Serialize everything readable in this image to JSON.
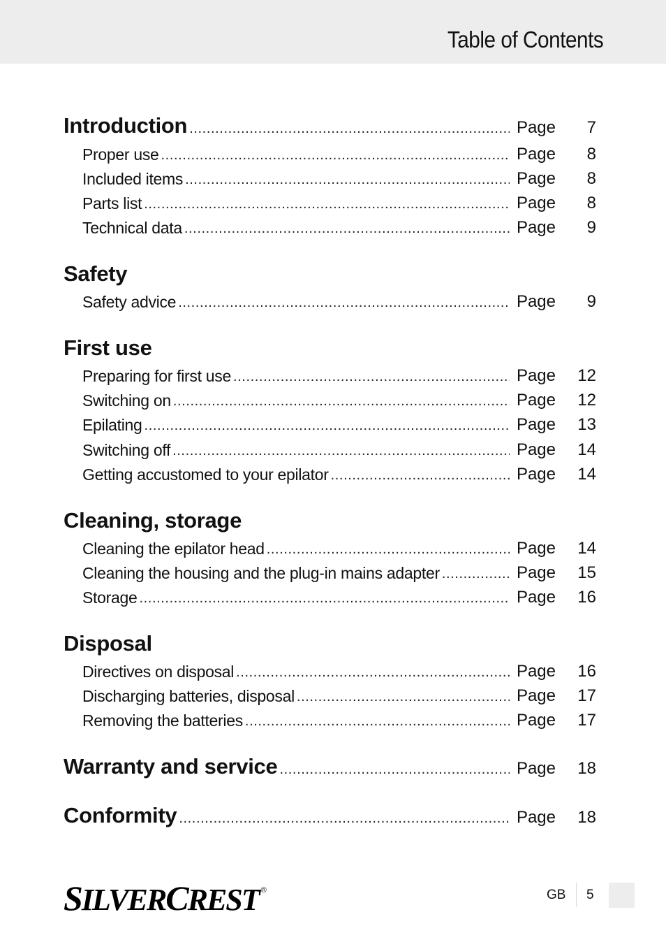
{
  "header": {
    "title": "Table of Contents"
  },
  "toc": {
    "page_word": "Page",
    "sections": [
      {
        "title": "Introduction",
        "page": "7",
        "items": [
          {
            "label": "Proper use",
            "page": "8"
          },
          {
            "label": "Included items",
            "page": "8"
          },
          {
            "label": "Parts list",
            "page": "8"
          },
          {
            "label": "Technical data",
            "page": "9"
          }
        ]
      },
      {
        "title": "Safety",
        "page": null,
        "items": [
          {
            "label": "Safety advice",
            "page": "9"
          }
        ]
      },
      {
        "title": "First use",
        "page": null,
        "items": [
          {
            "label": "Preparing for first use",
            "page": "12"
          },
          {
            "label": "Switching on",
            "page": "12"
          },
          {
            "label": "Epilating",
            "page": "13"
          },
          {
            "label": "Switching off",
            "page": "14"
          },
          {
            "label": "Getting accustomed to your epilator",
            "page": "14"
          }
        ]
      },
      {
        "title": "Cleaning, storage",
        "page": null,
        "items": [
          {
            "label": "Cleaning the epilator head",
            "page": "14"
          },
          {
            "label": "Cleaning the housing and the plug-in mains adapter",
            "page": "15"
          },
          {
            "label": "Storage",
            "page": "16"
          }
        ]
      },
      {
        "title": "Disposal",
        "page": null,
        "items": [
          {
            "label": "Directives on disposal",
            "page": "16"
          },
          {
            "label": "Discharging batteries, disposal",
            "page": "17"
          },
          {
            "label": "Removing the batteries",
            "page": "17"
          }
        ]
      },
      {
        "title": "Warranty and service",
        "page": "18",
        "items": []
      },
      {
        "title": "Conformity",
        "page": "18",
        "items": []
      }
    ]
  },
  "footer": {
    "brand": "SilverCrest",
    "brand_s": "S",
    "brand_ilver": "ILVER",
    "brand_c": "C",
    "brand_rest": "REST",
    "registered": "®",
    "language": "GB",
    "page_number": "5"
  }
}
